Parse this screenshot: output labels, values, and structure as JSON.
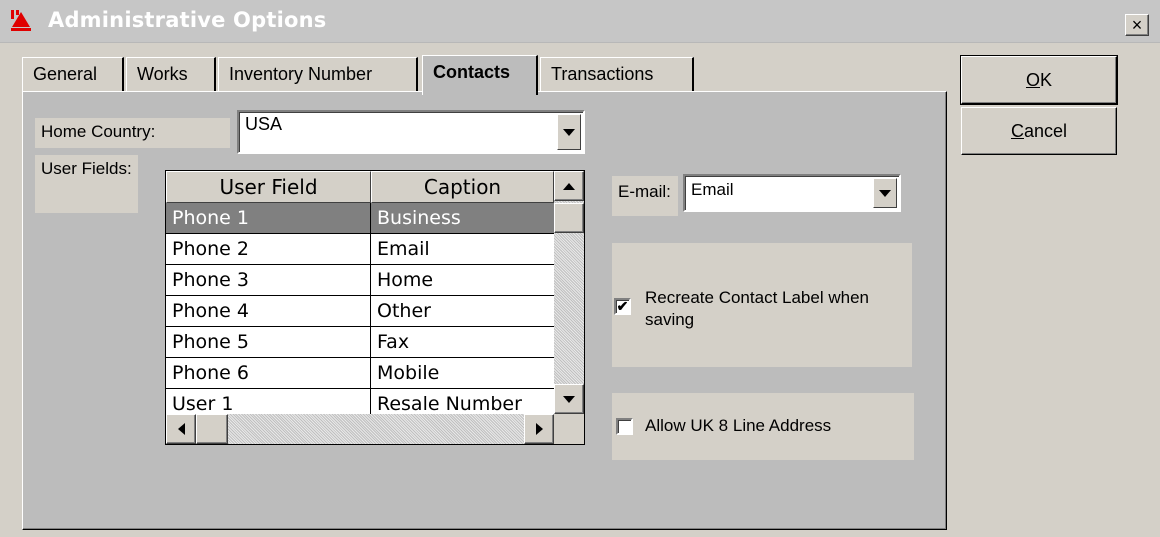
{
  "window": {
    "title": "Administrative Options",
    "close_glyph": "×"
  },
  "tabs": [
    {
      "label": "General"
    },
    {
      "label": "Works"
    },
    {
      "label": "Inventory Number"
    },
    {
      "label": "Contacts"
    },
    {
      "label": "Transactions"
    }
  ],
  "active_tab": "Contacts",
  "home_country": {
    "label": "Home Country:",
    "value": "USA"
  },
  "user_fields": {
    "label": "User Fields:",
    "columns": [
      "User Field",
      "Caption"
    ],
    "rows": [
      [
        "Phone 1",
        "Business"
      ],
      [
        "Phone 2",
        "Email"
      ],
      [
        "Phone 3",
        "Home"
      ],
      [
        "Phone 4",
        "Other"
      ],
      [
        "Phone 5",
        "Fax"
      ],
      [
        "Phone 6",
        "Mobile"
      ],
      [
        "User 1",
        "Resale Number"
      ]
    ],
    "selected_row": 0
  },
  "email": {
    "label": "E-mail:",
    "value": "Email"
  },
  "options": {
    "recreate_label": {
      "label": "Recreate Contact Label when saving",
      "checked": true
    },
    "uk_address": {
      "label": "Allow UK 8 Line Address",
      "checked": false
    }
  },
  "buttons": {
    "ok": {
      "mnemonic": "O",
      "rest": "K"
    },
    "cancel": {
      "mnemonic": "C",
      "rest": "ancel"
    }
  },
  "colors": {
    "selection": "#808080",
    "face": "#d4d0c8",
    "panel": "#bcbcbc"
  }
}
